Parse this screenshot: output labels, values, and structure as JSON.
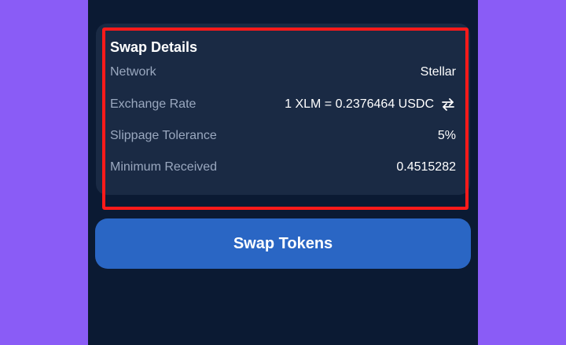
{
  "colors": {
    "background": "#8a5cf6",
    "screen": "#0b1a33",
    "card": "#1a2a44",
    "highlight": "#ff1a1a",
    "button": "#2a66c4",
    "label": "#9aa8bf",
    "value": "#ffffff"
  },
  "swap_details": {
    "title": "Swap Details",
    "rows": [
      {
        "label": "Network",
        "value": "Stellar"
      },
      {
        "label": "Exchange Rate",
        "value": "1 XLM = 0.2376464 USDC",
        "icon": "swap-arrows-icon"
      },
      {
        "label": "Slippage Tolerance",
        "value": "5%"
      },
      {
        "label": "Minimum Received",
        "value": "0.4515282"
      }
    ]
  },
  "swap_button": {
    "label": "Swap Tokens"
  }
}
